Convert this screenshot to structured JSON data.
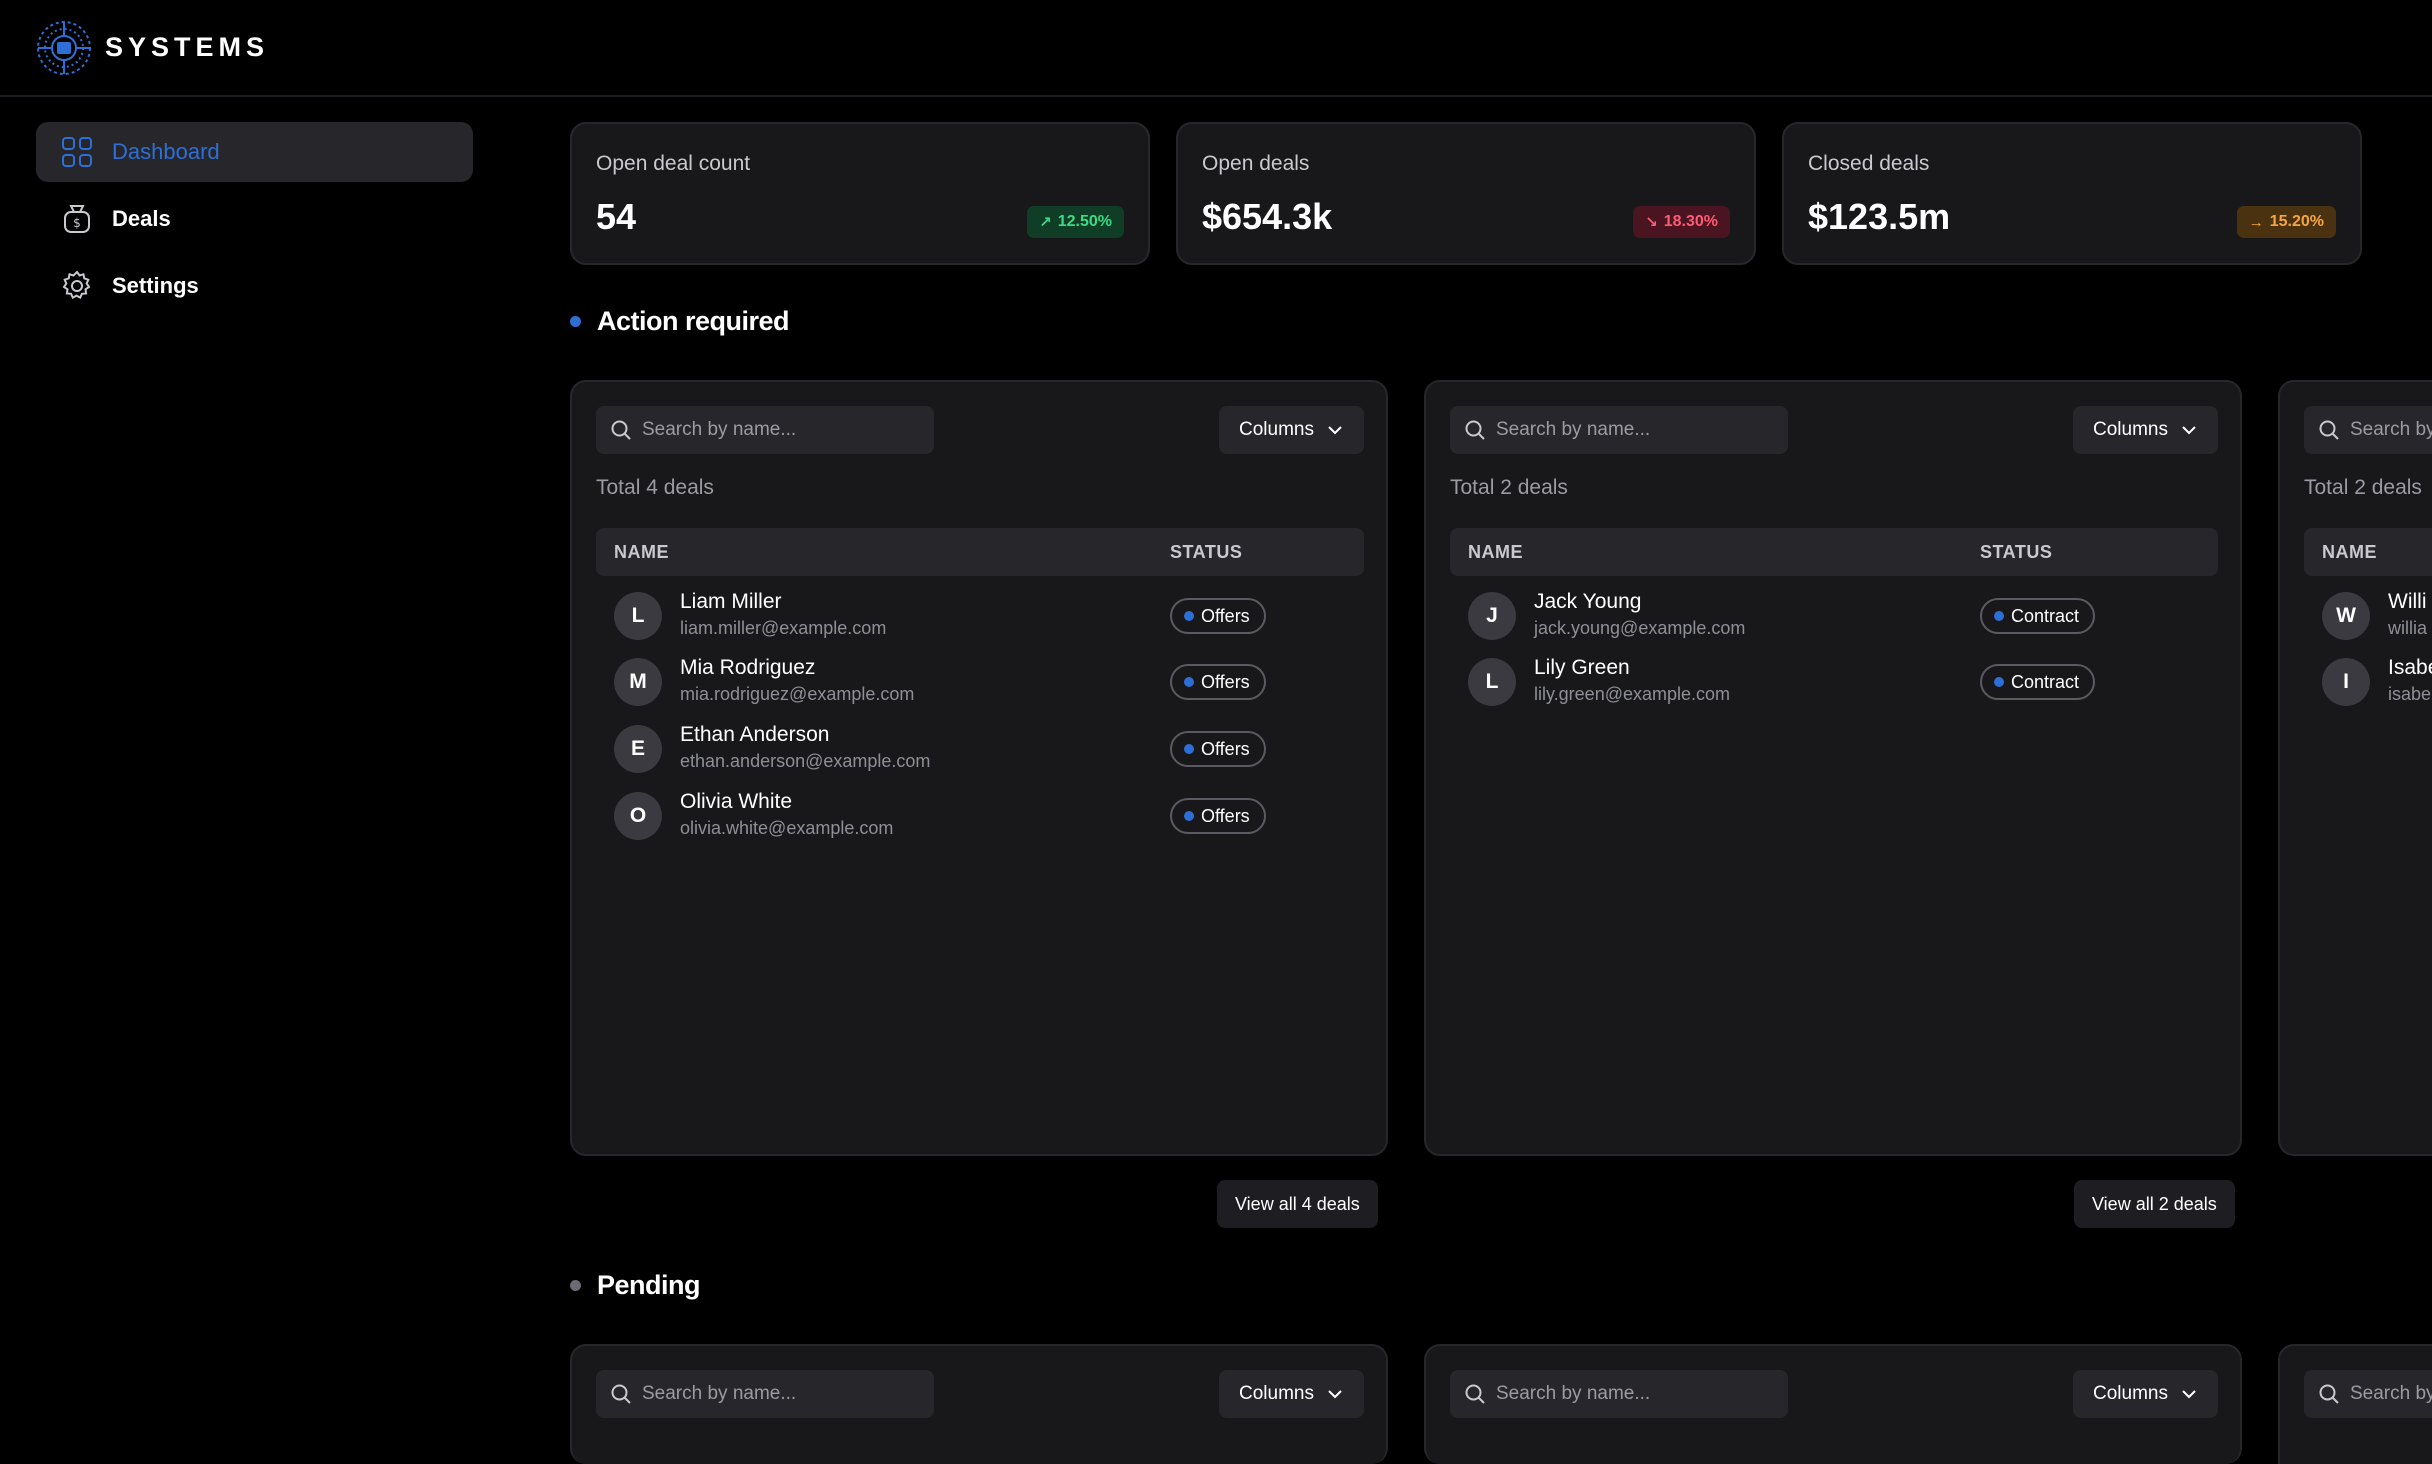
{
  "brand": {
    "name": "SYSTEMS"
  },
  "sidebar": {
    "items": [
      {
        "label": "Dashboard",
        "icon": "grid-icon",
        "active": true
      },
      {
        "label": "Deals",
        "icon": "money-bag-icon",
        "active": false
      },
      {
        "label": "Settings",
        "icon": "gear-icon",
        "active": false
      }
    ]
  },
  "stats": [
    {
      "label": "Open deal count",
      "value": "54",
      "change": "12.50%",
      "trend": "up"
    },
    {
      "label": "Open deals",
      "value": "$654.3k",
      "change": "18.30%",
      "trend": "down"
    },
    {
      "label": "Closed deals",
      "value": "$123.5m",
      "change": "15.20%",
      "trend": "flat"
    }
  ],
  "colors": {
    "accent": "#2d6fd6",
    "up": "#3ddc84",
    "down": "#ff5a76",
    "flat": "#f7a541",
    "pending_dot": "#6b6b73"
  },
  "sections": {
    "action_required": {
      "title": "Action required",
      "panels": [
        {
          "search_placeholder": "Search by name...",
          "columns_label": "Columns",
          "total": "Total 4 deals",
          "headers": {
            "name": "NAME",
            "status": "STATUS"
          },
          "rows": [
            {
              "initial": "L",
              "name": "Liam Miller",
              "email": "liam.miller@example.com",
              "status": "Offers"
            },
            {
              "initial": "M",
              "name": "Mia Rodriguez",
              "email": "mia.rodriguez@example.com",
              "status": "Offers"
            },
            {
              "initial": "E",
              "name": "Ethan Anderson",
              "email": "ethan.anderson@example.com",
              "status": "Offers"
            },
            {
              "initial": "O",
              "name": "Olivia White",
              "email": "olivia.white@example.com",
              "status": "Offers"
            }
          ],
          "view_all": "View all 4 deals"
        },
        {
          "search_placeholder": "Search by name...",
          "columns_label": "Columns",
          "total": "Total 2 deals",
          "headers": {
            "name": "NAME",
            "status": "STATUS"
          },
          "rows": [
            {
              "initial": "J",
              "name": "Jack Young",
              "email": "jack.young@example.com",
              "status": "Contract"
            },
            {
              "initial": "L",
              "name": "Lily Green",
              "email": "lily.green@example.com",
              "status": "Contract"
            }
          ],
          "view_all": "View all 2 deals"
        },
        {
          "search_placeholder": "Search by name...",
          "total": "Total 2 deals",
          "headers": {
            "name": "NAME"
          },
          "rows": [
            {
              "initial": "W",
              "name": "Willi",
              "email": "willia"
            },
            {
              "initial": "I",
              "name": "Isabe",
              "email": "isabe"
            }
          ]
        }
      ]
    },
    "pending": {
      "title": "Pending",
      "panels": [
        {
          "search_placeholder": "Search by name...",
          "columns_label": "Columns"
        },
        {
          "search_placeholder": "Search by name...",
          "columns_label": "Columns"
        },
        {
          "search_placeholder": "Search by name..."
        }
      ]
    }
  }
}
